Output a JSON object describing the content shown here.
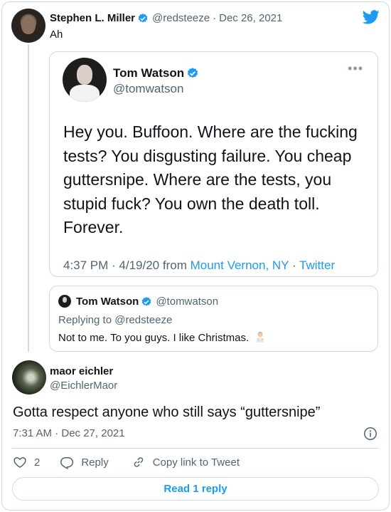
{
  "main_tweet": {
    "author_name": "Stephen L. Miller",
    "author_handle": "@redsteeze",
    "date": "Dec 26, 2021",
    "text": "Ah"
  },
  "quoted_tweet": {
    "author_name": "Tom Watson",
    "author_handle": "@tomwatson",
    "text": "Hey you. Buffoon. Where are the fucking tests? You disgusting failure. You cheap guttersnipe. Where are the tests, you stupid fuck? You own the death toll. Forever.",
    "time": "4:37 PM · 4/19/20 from",
    "location": "Mount Vernon, NY",
    "separator": "·",
    "source": "Twitter"
  },
  "reply_tweet": {
    "author_name": "Tom Watson",
    "author_handle": "@tomwatson",
    "replying_to": "Replying to @redsteeze",
    "text": "Not to me. To you guys. I like Christmas.",
    "emoji": "person-gesturing-emoji"
  },
  "maor_tweet": {
    "author_name": "maor eichler",
    "author_handle": "@EichlerMaor",
    "text": "Gotta respect anyone who still says “guttersnipe”",
    "timestamp": "7:31 AM · Dec 27, 2021"
  },
  "actions": {
    "like_count": "2",
    "reply_label": "Reply",
    "copy_label": "Copy link to Tweet"
  },
  "read_replies_label": "Read 1 reply",
  "colors": {
    "accent": "#1d9bf0",
    "muted": "#536471",
    "border": "#cfd9de"
  }
}
